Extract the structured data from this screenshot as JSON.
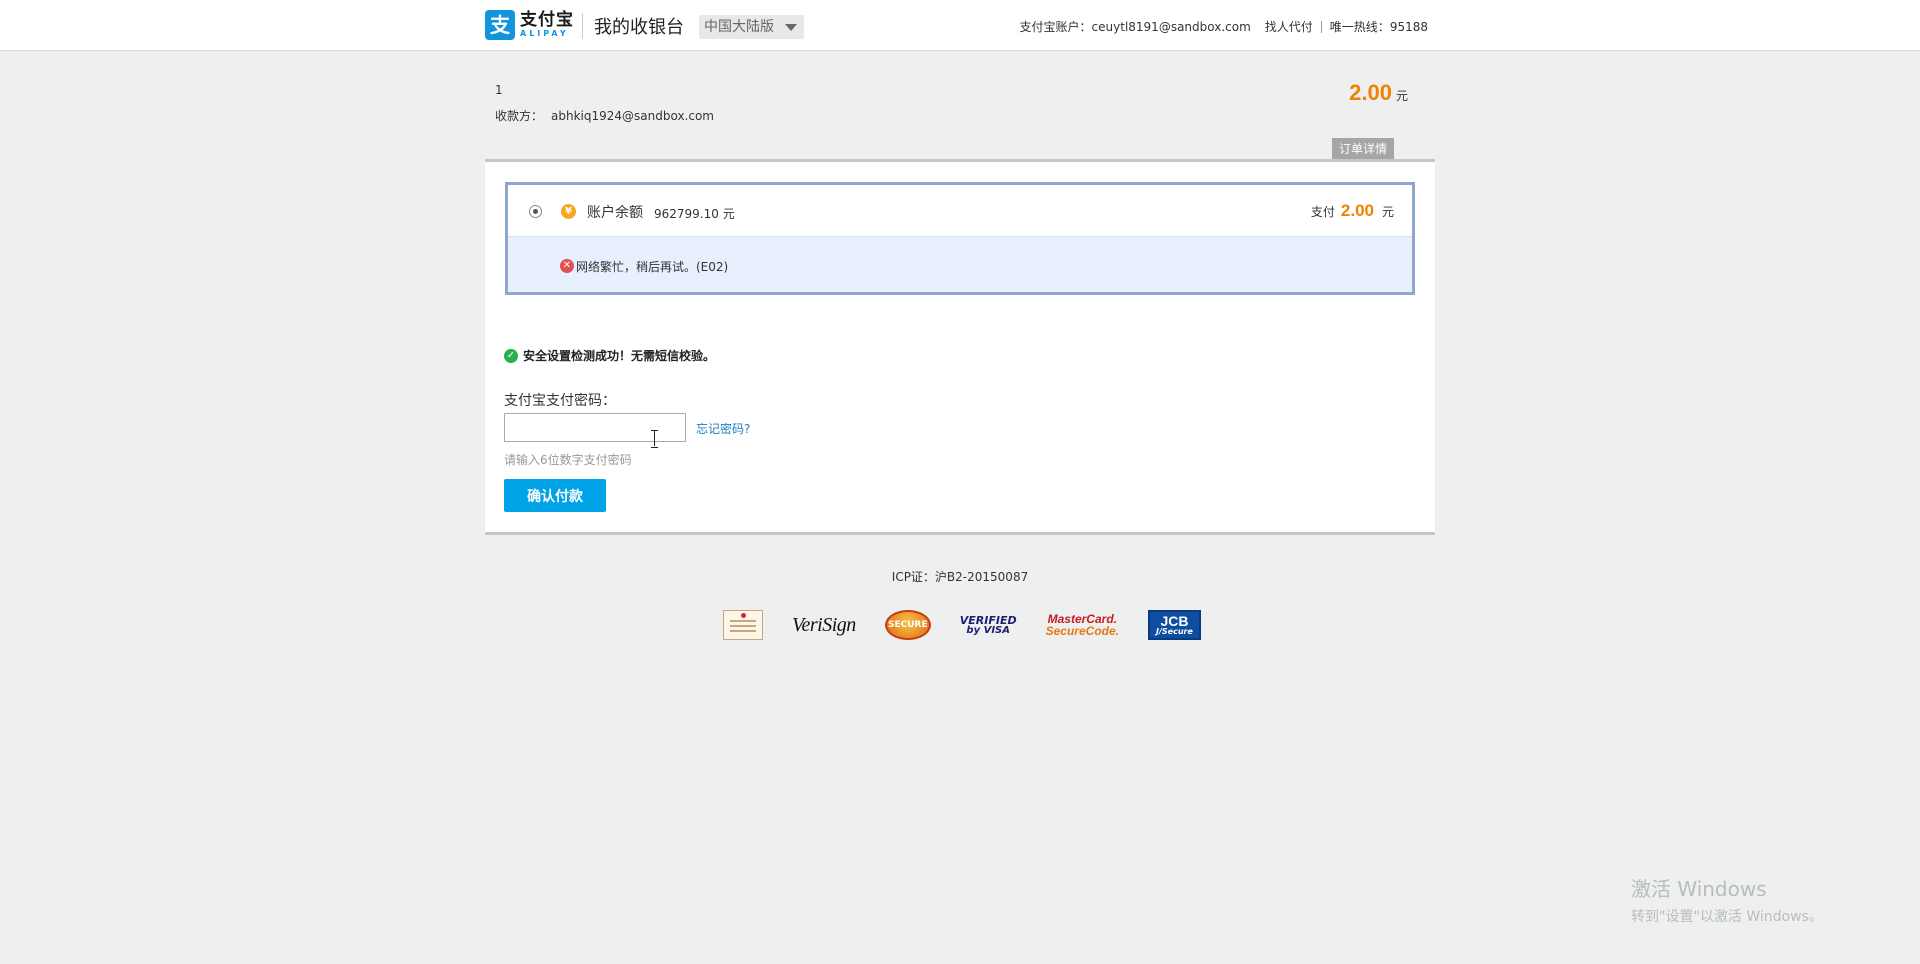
{
  "header": {
    "logo_cn": "支付宝",
    "logo_en": "ALIPAY",
    "logo_icon_char": "支",
    "cashier_title": "我的收银台",
    "region": "中国大陆版",
    "account_label": "支付宝账户：",
    "account_value": "ceuytl8191@sandbox.com",
    "find_payer": "找人代付",
    "hotline_label": "唯一热线：",
    "hotline_value": "95188"
  },
  "order": {
    "number": "1",
    "payee_label": "收款方：",
    "payee_value": "abhkiq1924@sandbox.com",
    "total_amount": "2.00",
    "total_unit": "元",
    "detail_tab": "订单详情"
  },
  "payment": {
    "method_icon_char": "¥",
    "balance_label": "账户余额",
    "balance_value": "962799.10 元",
    "pay_label": "支付",
    "pay_amount": "2.00",
    "pay_unit": "元",
    "error_icon_char": "✕",
    "error_text": "网络繁忙，稍后再试。(E02)"
  },
  "security": {
    "check_icon_char": "✓",
    "check_text": "安全设置检测成功！无需短信校验。",
    "password_label": "支付宝支付密码：",
    "password_value": "",
    "forgot_link": "忘记密码?",
    "password_hint": "请输入6位数字支付密码",
    "confirm_button": "确认付款"
  },
  "footer": {
    "icp": "ICP证：沪B2-20150087",
    "badges": {
      "verisign": "VeriSign",
      "secure": "SECURE",
      "visa_line1": "VERIFIED",
      "visa_line2": "by VISA",
      "mc_line1": "MasterCard.",
      "mc_line2": "SecureCode.",
      "jcb_line1": "JCB",
      "jcb_line2": "J/Secure"
    }
  },
  "watermark": {
    "line1": "激活 Windows",
    "line2": "转到\"设置\"以激活 Windows。"
  },
  "colors": {
    "accent_orange": "#f08200",
    "button_blue": "#00a3e8",
    "link_blue": "#1d7fc4",
    "selection_border": "#8fa6d2",
    "error_bg": "#e7f0fc"
  }
}
